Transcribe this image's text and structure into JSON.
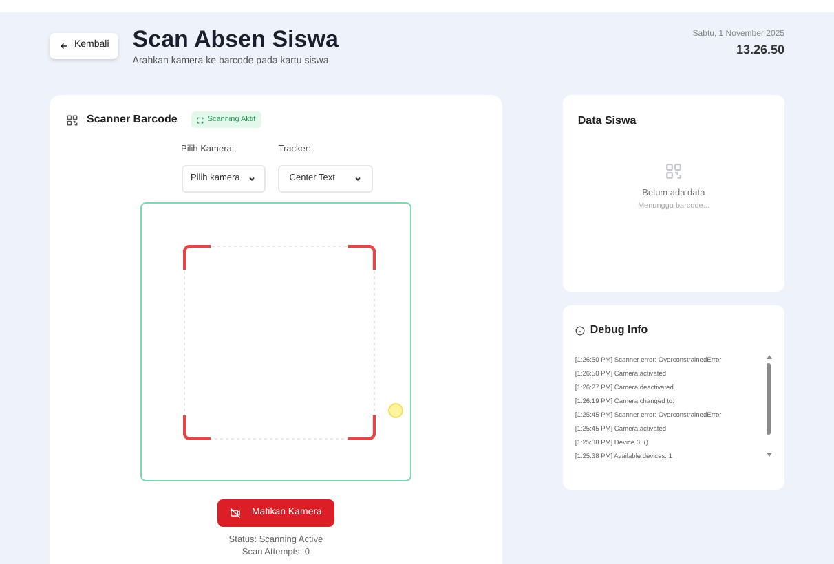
{
  "header": {
    "back_button": "Kembali",
    "title": "Scan Absen Siswa",
    "subtitle": "Arahkan kamera ke barcode pada kartu siswa",
    "date": "Sabtu, 1 November 2025",
    "time": "13.26.50"
  },
  "scanner": {
    "title": "Scanner Barcode",
    "status_badge": "Scanning Aktif",
    "camera_label": "Pilih Kamera:",
    "camera_value": "Pilih kamera",
    "tracker_label": "Tracker:",
    "tracker_value": "Center Text",
    "stop_button": "Matikan Kamera",
    "status_lines": [
      "Status: Scanning Active",
      "Scan Attempts: 0"
    ]
  },
  "student_data": {
    "title": "Data Siswa",
    "empty_title": "Belum ada data",
    "empty_hint": "Menunggu barcode..."
  },
  "debug": {
    "title": "Debug Info",
    "log": [
      "[1:26:50 PM] Scanner error: OverconstrainedError",
      "[1:26:50 PM] Camera activated",
      "[1:26:27 PM] Camera deactivated",
      "[1:26:19 PM] Camera changed to:",
      "[1:25:45 PM] Scanner error: OverconstrainedError",
      "[1:25:45 PM] Camera activated",
      "[1:25:38 PM] Device 0: ()",
      "[1:25:38 PM] Available devices: 1"
    ]
  }
}
